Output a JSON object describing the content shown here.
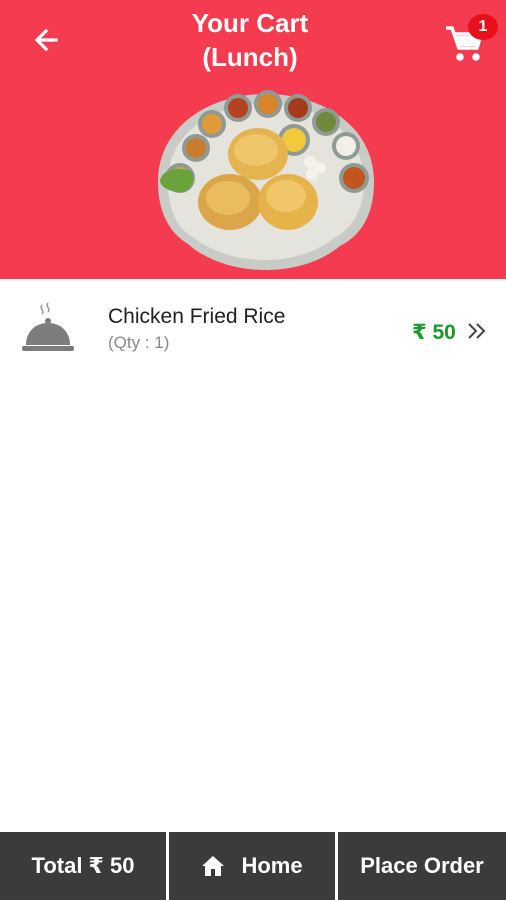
{
  "header": {
    "title_line1": "Your Cart",
    "title_line2": "(Lunch)",
    "cart_count": "1",
    "back_icon": "arrow-left-icon",
    "cart_icon": "shopping-cart-icon"
  },
  "colors": {
    "header_bg": "#f43b4f",
    "badge_bg": "#e8101a",
    "price": "#1a9a2a",
    "footer_bg": "#3b3b3b"
  },
  "cart": {
    "items": [
      {
        "name": "Chicken Fried Rice",
        "qty": "(Qty : 1)",
        "price": "₹ 50",
        "icon": "food-cloche-icon"
      }
    ]
  },
  "footer": {
    "total": "Total ₹ 50",
    "home": "Home",
    "place_order": "Place Order"
  }
}
